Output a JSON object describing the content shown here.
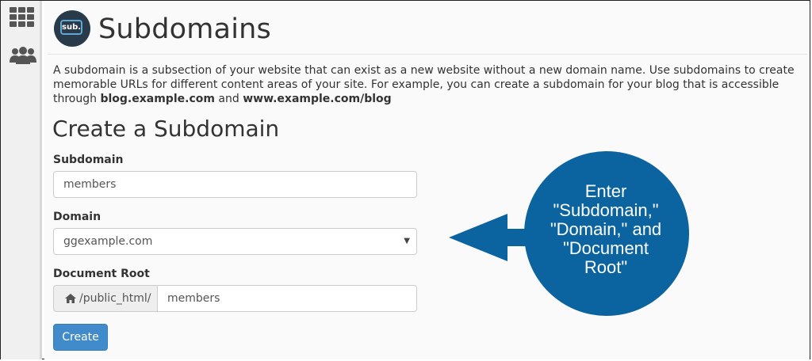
{
  "sidebar": {
    "items": [
      {
        "icon": "grid-icon"
      },
      {
        "icon": "users-icon"
      }
    ]
  },
  "header": {
    "logo_text": "sub.",
    "title": "Subdomains"
  },
  "description": {
    "line1": "A subdomain is a subsection of your website that can exist as a new website without a new domain name. Use subdomains to create memorable URLs for different content areas of your site. For example, you can create a subdomain for your blog that is accessible through",
    "example1": "blog.example.com",
    "and": "and",
    "example2": "www.example.com/blog"
  },
  "form": {
    "section_title": "Create a Subdomain",
    "subdomain_label": "Subdomain",
    "subdomain_value": "members",
    "domain_label": "Domain",
    "domain_value": "ggexample.com",
    "docroot_label": "Document Root",
    "docroot_prefix": "/public_html/",
    "docroot_value": "members",
    "create_label": "Create"
  },
  "callout": {
    "line1": "Enter",
    "line2": "\"Subdomain,\"",
    "line3": "\"Domain,\" and",
    "line4": "\"Document",
    "line5": "Root\"",
    "color": "#0b64a0"
  },
  "colors": {
    "accent": "#428bca",
    "callout": "#0b64a0"
  }
}
